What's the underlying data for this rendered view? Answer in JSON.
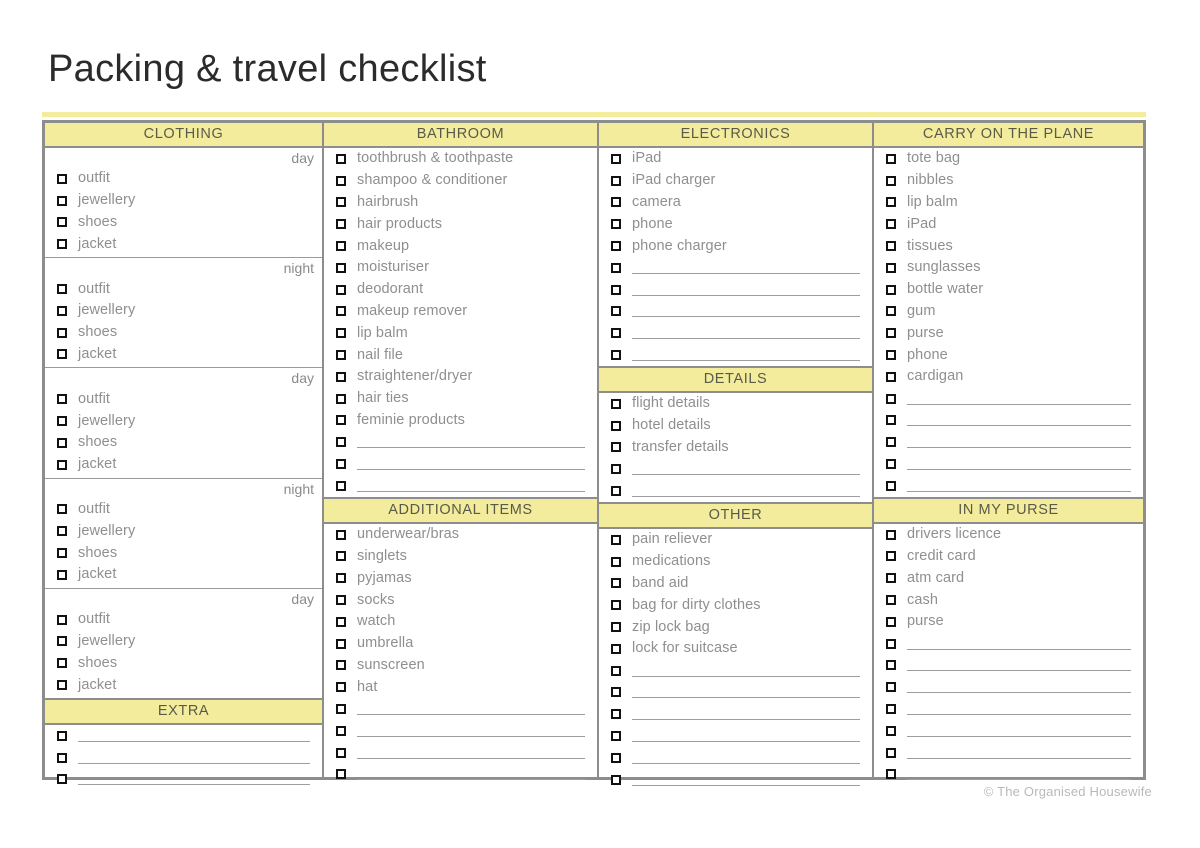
{
  "document": {
    "title": "Packing & travel checklist",
    "footer_credit": "© The Organised Housewife"
  },
  "colors": {
    "band_yellow": "#f3ec9d",
    "frame_gray": "#8d8d8d",
    "text_gray": "#8f8f8f",
    "title_dark": "#2b2b2b"
  },
  "columns": [
    {
      "name": "clothing",
      "sections": [
        {
          "header": "CLOTHING",
          "groups": [
            {
              "label": "day",
              "items": [
                "outfit",
                "jewellery",
                "shoes",
                "jacket"
              ]
            },
            {
              "label": "night",
              "items": [
                "outfit",
                "jewellery",
                "shoes",
                "jacket"
              ]
            },
            {
              "label": "day",
              "items": [
                "outfit",
                "jewellery",
                "shoes",
                "jacket"
              ]
            },
            {
              "label": "night",
              "items": [
                "outfit",
                "jewellery",
                "shoes",
                "jacket"
              ]
            },
            {
              "label": "day",
              "items": [
                "outfit",
                "jewellery",
                "shoes",
                "jacket"
              ]
            }
          ]
        },
        {
          "header": "EXTRA",
          "items": [],
          "blanks": 3
        }
      ]
    },
    {
      "name": "bathroom",
      "sections": [
        {
          "header": "BATHROOM",
          "items": [
            "toothbrush & toothpaste",
            "shampoo & conditioner",
            "hairbrush",
            "hair products",
            "makeup",
            "moisturiser",
            "deodorant",
            "makeup remover",
            "lip balm",
            "nail file",
            "straightener/dryer",
            "hair ties",
            "feminie products"
          ],
          "blanks": 3
        },
        {
          "header": "ADDITIONAL ITEMS",
          "items": [
            "underwear/bras",
            "singlets",
            "pyjamas",
            "socks",
            "watch",
            "umbrella",
            "sunscreen",
            "hat"
          ],
          "blanks": 4
        }
      ]
    },
    {
      "name": "electronics",
      "sections": [
        {
          "header": "ELECTRONICS",
          "items": [
            "iPad",
            "iPad charger",
            "camera",
            "phone",
            "phone charger"
          ],
          "blanks": 5
        },
        {
          "header": "DETAILS",
          "items": [
            "flight details",
            "hotel details",
            "transfer details"
          ],
          "blanks": 2
        },
        {
          "header": "OTHER",
          "items": [
            "pain reliever",
            "medications",
            "band aid",
            "bag for dirty clothes",
            "zip lock bag",
            "lock for suitcase"
          ],
          "blanks": 6
        }
      ]
    },
    {
      "name": "carry-on",
      "sections": [
        {
          "header": "CARRY ON THE PLANE",
          "items": [
            "tote bag",
            "nibbles",
            "lip balm",
            "iPad",
            "tissues",
            "sunglasses",
            "bottle water",
            "gum",
            "purse",
            "phone",
            "cardigan"
          ],
          "blanks": 5
        },
        {
          "header": "IN MY PURSE",
          "items": [
            "drivers licence",
            "credit card",
            "atm card",
            "cash",
            "purse"
          ],
          "blanks": 7
        }
      ]
    }
  ]
}
